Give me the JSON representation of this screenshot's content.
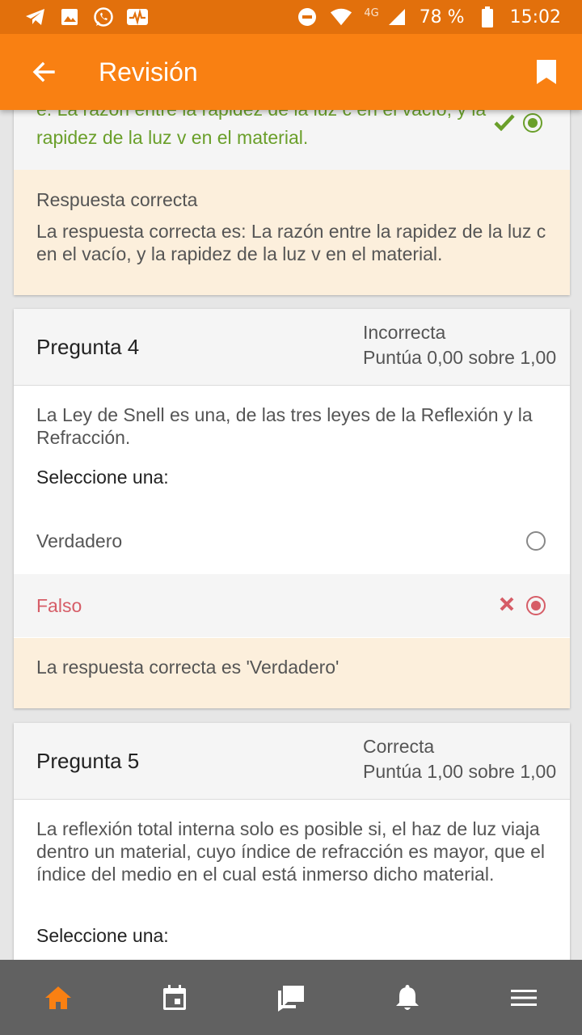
{
  "status_bar": {
    "battery": "78 %",
    "time": "15:02",
    "network": "4G",
    "left_icons": [
      "telegram-icon",
      "image-icon",
      "whatsapp-icon",
      "activity-icon"
    ],
    "right_icons": [
      "dnd-icon",
      "wifi-icon",
      "signal-icon",
      "battery-icon"
    ]
  },
  "app_bar": {
    "title": "Revisión",
    "back_icon": "arrow-left-icon",
    "bookmark_icon": "bookmark-icon"
  },
  "question3": {
    "option_partial_top": "e. La razón entre la rapidez de la luz c en el vacío, y la",
    "option_partial_bottom": "rapidez de la luz v en el material.",
    "feedback_title": "Respuesta correcta",
    "feedback_text": "La respuesta correcta es: La razón entre la rapidez de la luz c en el vacío, y la rapidez de la luz v en el material."
  },
  "question4": {
    "title": "Pregunta 4",
    "state": "Incorrecta",
    "grade": "Puntúa 0,00 sobre 1,00",
    "text": "La Ley de Snell es una, de las tres leyes de la Reflexión y la Refracción.",
    "select_label": "Seleccione una:",
    "options": [
      {
        "label": "Verdadero",
        "selected": false
      },
      {
        "label": "Falso",
        "selected": true,
        "mark": "incorrect"
      }
    ],
    "feedback_text": "La respuesta correcta es 'Verdadero'"
  },
  "question5": {
    "title": "Pregunta 5",
    "state": "Correcta",
    "grade": "Puntúa 1,00 sobre 1,00",
    "text": "La reflexión total interna solo es posible si, el haz de luz viaja dentro un material, cuyo índice de refracción es mayor, que el índice del medio en el cual está inmerso dicho material.",
    "select_label": "Seleccione una:"
  },
  "bottom_nav": [
    {
      "icon": "home-icon",
      "active": true
    },
    {
      "icon": "calendar-icon",
      "active": false
    },
    {
      "icon": "messages-icon",
      "active": false
    },
    {
      "icon": "bell-icon",
      "active": false
    },
    {
      "icon": "menu-icon",
      "active": false
    }
  ],
  "colors": {
    "status_bar": "#e2700c",
    "app_bar": "#f98012",
    "correct": "#6a9f2a",
    "incorrect": "#d65d67",
    "feedback_bg": "#fcefdc",
    "nav_bg": "#616161",
    "nav_active": "#f98012"
  }
}
